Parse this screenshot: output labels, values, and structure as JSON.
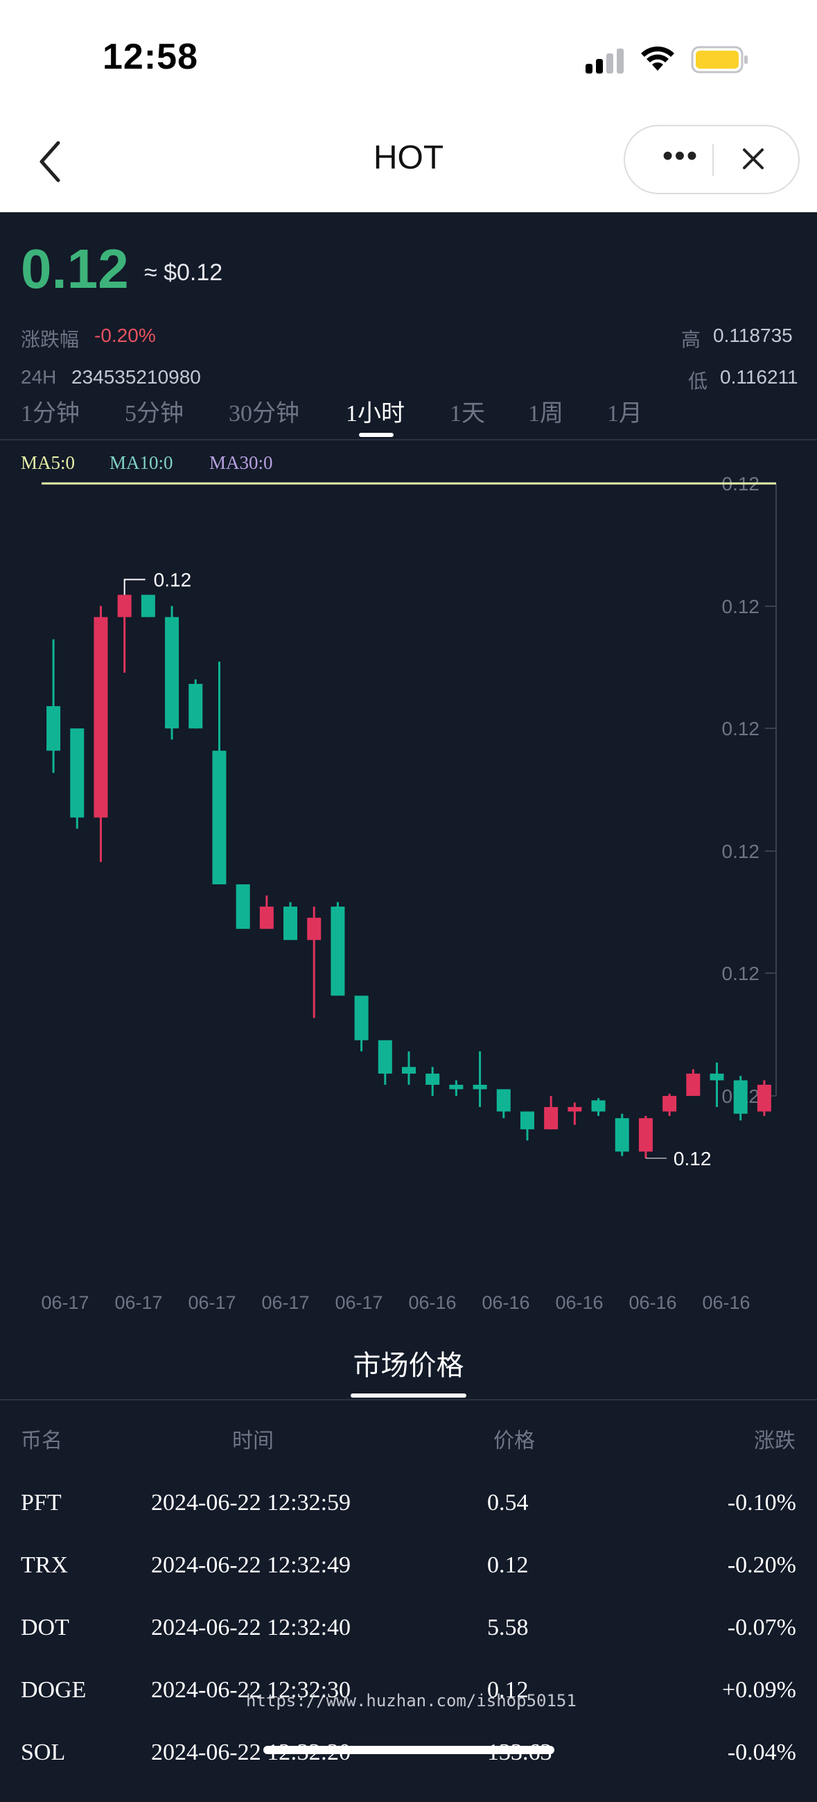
{
  "status": {
    "time": "12:58"
  },
  "nav": {
    "title": "HOT"
  },
  "ticker": {
    "price": "0.12",
    "usd": "≈ $0.12",
    "change_label": "涨跌幅",
    "change_value": "-0.20%",
    "high_label": "高",
    "high_value": "0.118735",
    "volume_label": "24H",
    "volume_value": "234535210980",
    "low_label": "低",
    "low_value": "0.116211"
  },
  "intervals": [
    "1分钟",
    "5分钟",
    "30分钟",
    "1小时",
    "1天",
    "1周",
    "1月"
  ],
  "active_interval": "1小时",
  "ma": {
    "ma5": "MA5:0",
    "ma10": "MA10:0",
    "ma30": "MA30:0"
  },
  "colors": {
    "up": "#e0335c",
    "down": "#10b495",
    "price_green": "#3db37a",
    "ma5": "#e7f0a8",
    "ma10": "#7fd1c7",
    "ma30": "#b7a0e0"
  },
  "chart_data": {
    "type": "candlestick",
    "y_tick_labels": [
      "0.12",
      "0.12",
      "0.12",
      "0.12",
      "0.12",
      "0.12"
    ],
    "x_tick_labels": [
      "06-17",
      "06-17",
      "06-17",
      "06-17",
      "06-17",
      "06-16",
      "06-16",
      "06-16",
      "06-16",
      "06-16"
    ],
    "max_label": "0.12",
    "min_label": "0.12",
    "ylim": [
      0.11605,
      0.1188
    ],
    "ma5_level": 0.1188,
    "candles": [
      {
        "o": 0.1178,
        "c": 0.1176,
        "h": 0.1181,
        "l": 0.1175
      },
      {
        "o": 0.1177,
        "c": 0.1173,
        "h": 0.1177,
        "l": 0.11725
      },
      {
        "o": 0.1173,
        "c": 0.1182,
        "h": 0.11825,
        "l": 0.1171
      },
      {
        "o": 0.1182,
        "c": 0.1183,
        "h": 0.1183,
        "l": 0.11795
      },
      {
        "o": 0.1183,
        "c": 0.1182,
        "h": 0.1183,
        "l": 0.1182
      },
      {
        "o": 0.1182,
        "c": 0.1177,
        "h": 0.11825,
        "l": 0.11765
      },
      {
        "o": 0.1179,
        "c": 0.1177,
        "h": 0.11792,
        "l": 0.1177
      },
      {
        "o": 0.1176,
        "c": 0.117,
        "h": 0.118,
        "l": 0.117
      },
      {
        "o": 0.117,
        "c": 0.1168,
        "h": 0.117,
        "l": 0.1168
      },
      {
        "o": 0.1168,
        "c": 0.1169,
        "h": 0.11695,
        "l": 0.1168
      },
      {
        "o": 0.1169,
        "c": 0.11675,
        "h": 0.11692,
        "l": 0.11675
      },
      {
        "o": 0.11675,
        "c": 0.11685,
        "h": 0.1169,
        "l": 0.1164
      },
      {
        "o": 0.1169,
        "c": 0.1165,
        "h": 0.11692,
        "l": 0.1165
      },
      {
        "o": 0.1165,
        "c": 0.1163,
        "h": 0.1165,
        "l": 0.11625
      },
      {
        "o": 0.1163,
        "c": 0.11615,
        "h": 0.1163,
        "l": 0.1161
      },
      {
        "o": 0.11618,
        "c": 0.11615,
        "h": 0.11625,
        "l": 0.1161
      },
      {
        "o": 0.11615,
        "c": 0.1161,
        "h": 0.11618,
        "l": 0.11605
      },
      {
        "o": 0.1161,
        "c": 0.11608,
        "h": 0.11612,
        "l": 0.11605
      },
      {
        "o": 0.1161,
        "c": 0.11608,
        "h": 0.11625,
        "l": 0.116
      },
      {
        "o": 0.11608,
        "c": 0.11598,
        "h": 0.11608,
        "l": 0.11595
      },
      {
        "o": 0.11598,
        "c": 0.1159,
        "h": 0.11598,
        "l": 0.11585
      },
      {
        "o": 0.1159,
        "c": 0.116,
        "h": 0.11605,
        "l": 0.1159
      },
      {
        "o": 0.11598,
        "c": 0.116,
        "h": 0.11602,
        "l": 0.11592
      },
      {
        "o": 0.11603,
        "c": 0.11598,
        "h": 0.11604,
        "l": 0.11596
      },
      {
        "o": 0.11595,
        "c": 0.1158,
        "h": 0.11597,
        "l": 0.11578
      },
      {
        "o": 0.1158,
        "c": 0.11595,
        "h": 0.11596,
        "l": 0.11577
      },
      {
        "o": 0.11598,
        "c": 0.11605,
        "h": 0.11606,
        "l": 0.11596
      },
      {
        "o": 0.11605,
        "c": 0.11615,
        "h": 0.11617,
        "l": 0.11605
      },
      {
        "o": 0.11615,
        "c": 0.11612,
        "h": 0.1162,
        "l": 0.116
      },
      {
        "o": 0.11612,
        "c": 0.11597,
        "h": 0.11614,
        "l": 0.11594
      },
      {
        "o": 0.11598,
        "c": 0.1161,
        "h": 0.11612,
        "l": 0.11596
      }
    ]
  },
  "market": {
    "title": "市场价格",
    "headers": [
      "币名",
      "时间",
      "价格",
      "涨跌"
    ],
    "rows": [
      {
        "name": "PFT",
        "time": "2024-06-22 12:32:59",
        "price": "0.54",
        "change": "-0.10%"
      },
      {
        "name": "TRX",
        "time": "2024-06-22 12:32:49",
        "price": "0.12",
        "change": "-0.20%"
      },
      {
        "name": "DOT",
        "time": "2024-06-22 12:32:40",
        "price": "5.58",
        "change": "-0.07%"
      },
      {
        "name": "DOGE",
        "time": "2024-06-22 12:32:30",
        "price": "0.12",
        "change": "+0.09%"
      },
      {
        "name": "SOL",
        "time": "2024-06-22 12:32:20",
        "price": "133.63",
        "change": "-0.04%"
      }
    ]
  },
  "watermark": "https://www.huzhan.com/ishop50151"
}
